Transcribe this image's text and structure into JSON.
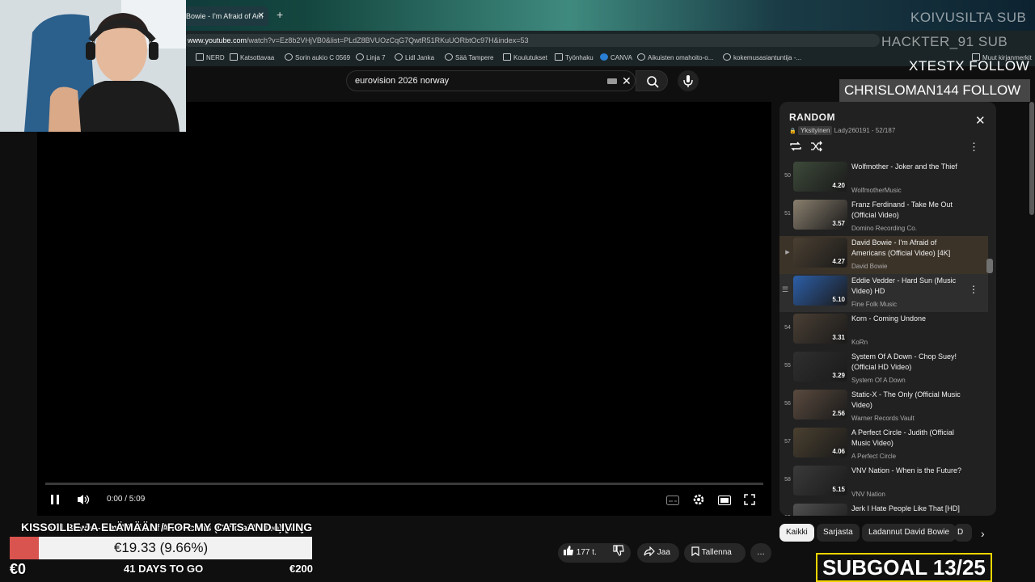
{
  "browser": {
    "tab_title": "Bowie - I'm Afraid of Am",
    "tab_close": "✕",
    "new_tab": "+",
    "url_host": "www.youtube.com",
    "url_rest": "/watch?v=Ez8b2VHjVB0&list=PLdZ8BVUOzCqG7QwtR51RKuUORbtOc97H&index=53",
    "bookmarks": [
      "NERD",
      "Katsottavaa",
      "Sorin aukio C 0569",
      "Linja 7",
      "Lidl Janka",
      "Sää Tampere",
      "Koulutukset",
      "Työnhaku",
      "CANVA",
      "Aikuisten omahoito-o...",
      "kokemusasiantuntija -..."
    ],
    "bookmarks_right": "Muut kirjanmerkit"
  },
  "search": {
    "query": "eurovision 2026 norway",
    "clear_icon": "✕"
  },
  "player": {
    "time": "0:00 / 5:09",
    "progress": 0
  },
  "video": {
    "title": "David Bowie - I'm Afraid of Americans (Official Video) [4K]",
    "likes": "177 t.",
    "share": "Jaa",
    "save": "Tallenna",
    "more": "…"
  },
  "playlist": {
    "title": "RANDOM",
    "privacy": "Yksityinen",
    "owner_progress": "Lady260191 - 52/187",
    "close": "✕",
    "items": [
      {
        "index": "50",
        "title": "Wolfmother - Joker and the Thief",
        "channel": "WolfmotherMusic",
        "duration": "4.20",
        "color": "#3d4a3a"
      },
      {
        "index": "51",
        "title": "Franz Ferdinand - Take Me Out (Official Video)",
        "channel": "Domino Recording Co.",
        "duration": "3.57",
        "color": "#8a7f6e"
      },
      {
        "index": "▶",
        "title": "David Bowie - I'm Afraid of Americans (Official Video) [4K]",
        "channel": "David Bowie",
        "duration": "4.27",
        "color": "#4b4032"
      },
      {
        "index": "",
        "title": "Eddie Vedder - Hard Sun (Music Video) HD",
        "channel": "Fine Folk Music",
        "duration": "5.10",
        "color": "#2d5fa8"
      },
      {
        "index": "54",
        "title": "Korn - Coming Undone",
        "channel": "KoRn",
        "duration": "3.31",
        "color": "#4a3f34"
      },
      {
        "index": "55",
        "title": "System Of A Down - Chop Suey! (Official HD Video)",
        "channel": "System Of A Down",
        "duration": "3.29",
        "color": "#2f2f2f"
      },
      {
        "index": "56",
        "title": "Static-X - The Only (Official Music Video)",
        "channel": "Warner Records Vault",
        "duration": "2.56",
        "color": "#5a4a3e"
      },
      {
        "index": "57",
        "title": "A Perfect Circle - Judith (Official Music Video)",
        "channel": "A Perfect Circle",
        "duration": "4.06",
        "color": "#4a4030"
      },
      {
        "index": "58",
        "title": "VNV Nation - When is the Future?",
        "channel": "VNV Nation",
        "duration": "5.15",
        "color": "#3a3a3a"
      },
      {
        "index": "59",
        "title": "Jerk I Hate People Like That [HD]",
        "channel": "",
        "duration": "",
        "color": "#505050"
      }
    ]
  },
  "chips": [
    "Kaikki",
    "Sarjasta",
    "Ladannut David Bowie",
    "D"
  ],
  "stream_overlay": {
    "top_right_1": "KOIVUSILTA SUB",
    "top_right_2": "HACKTER_91 SUB",
    "top_right_3": "XTESTX FOLLOW",
    "follow_banner": "CHRISLOMAN144 FOLLOW",
    "goal_title": "KISSOILLE JA ELÄMÄÄN / FOR MY CATS AND LIVING",
    "goal_amount": "€19.33 (9.66%)",
    "goal_fraction": 0.0966,
    "goal_start": "€0",
    "goal_days": "41 DAYS TO GO",
    "goal_end": "€200",
    "subgoal": "SUBGOAL 13/25"
  }
}
